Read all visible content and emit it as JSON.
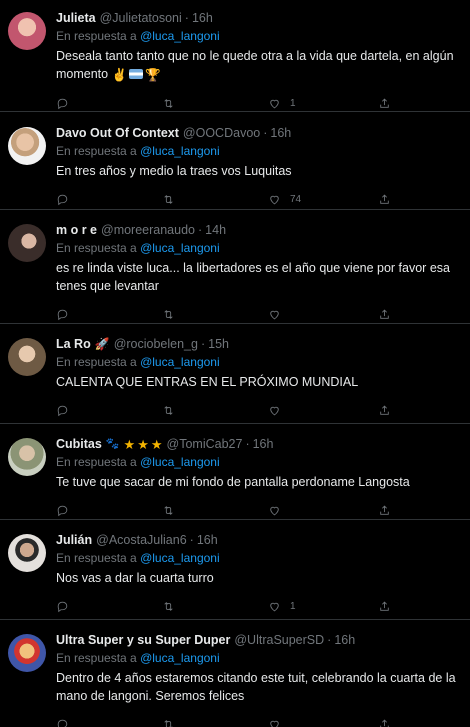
{
  "reply_prefix": "En respuesta a",
  "tweets": [
    {
      "name": "Julieta",
      "handle": "@Julietatosoni",
      "time": "16h",
      "mention": "@luca_langoni",
      "text": "Deseala tanto tanto que no le quede otra a la vida que dartela, en algún momento",
      "likes": "1",
      "avatar_color": "#c2566e"
    },
    {
      "name": "Davo Out Of Context",
      "handle": "@OOCDavoo",
      "time": "16h",
      "mention": "@luca_langoni",
      "text": "En tres años y medio la traes vos Luquitas",
      "likes": "74",
      "avatar_color": "#b48a74"
    },
    {
      "name": "m o r e",
      "handle": "@moreeranaudo",
      "time": "14h",
      "mention": "@luca_langoni",
      "text": "es re linda viste luca... la libertadores es el año que viene por favor esa tenes que levantar",
      "likes": "",
      "avatar_color": "#5b4a44"
    },
    {
      "name": "La Ro",
      "handle": "@rociobelen_g",
      "time": "15h",
      "mention": "@luca_langoni",
      "text": "CALENTA QUE ENTRAS EN EL PRÓXIMO MUNDIAL",
      "likes": "",
      "avatar_color": "#8f7b63"
    },
    {
      "name": "Cubitas",
      "handle": "@TomiCab27",
      "time": "16h",
      "mention": "@luca_langoni",
      "text": "Te tuve que sacar de mi fondo de pantalla perdoname Langosta",
      "likes": "",
      "avatar_color": "#9ea58f"
    },
    {
      "name": "Julián",
      "handle": "@AcostaJulian6",
      "time": "16h",
      "mention": "@luca_langoni",
      "text": "Nos vas a dar la cuarta turro",
      "likes": "1",
      "avatar_color": "#d8d4d0"
    },
    {
      "name": "Ultra Super y su Super Duper",
      "handle": "@UltraSuperSD",
      "time": "16h",
      "mention": "@luca_langoni",
      "text": "Dentro de 4 años estaremos citando este tuit, celebrando la cuarta de la mano de langoni. Seremos felices",
      "likes": "",
      "avatar_color": "#3f56a8"
    }
  ]
}
